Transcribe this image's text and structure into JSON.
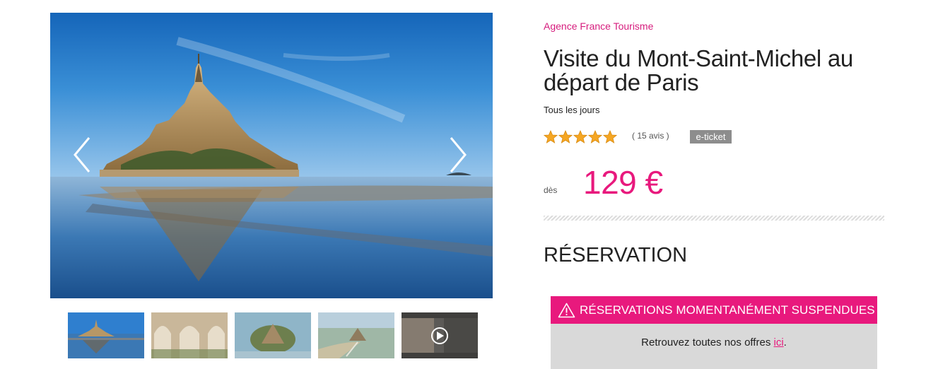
{
  "gallery": {
    "main_image": "mont-saint-michel-reflection-photo",
    "prev_icon": "chevron-left-icon",
    "next_icon": "chevron-right-icon",
    "thumbnails": [
      {
        "name": "thumb-mont-saint-michel-reflection"
      },
      {
        "name": "thumb-cloister-arches"
      },
      {
        "name": "thumb-aerial-island"
      },
      {
        "name": "thumb-aerial-bay"
      },
      {
        "name": "thumb-video-street",
        "is_video": true,
        "icon": "play-icon"
      }
    ]
  },
  "product": {
    "vendor": "Agence France Tourisme",
    "title": "Visite du Mont-Saint-Michel au départ de Paris",
    "schedule": "Tous les jours",
    "rating": 5,
    "rating_max": 5,
    "reviews": "( 15 avis )",
    "badge": "e-ticket",
    "price_prefix": "dès",
    "price": "129 €"
  },
  "reservation": {
    "title": "RÉSERVATION",
    "alert_title": "RÉSERVATIONS MOMENTANÉMENT SUSPENDUES",
    "alert_icon": "warning-icon",
    "message_before": "Retrouvez toutes nos offres ",
    "link_text": "ici",
    "message_after": "."
  },
  "colors": {
    "accent": "#e8197d",
    "vendor": "#d61c7d",
    "badge_bg": "#8d8d8d",
    "alert_body_bg": "#d9d9d9",
    "star": "#f5a623"
  }
}
